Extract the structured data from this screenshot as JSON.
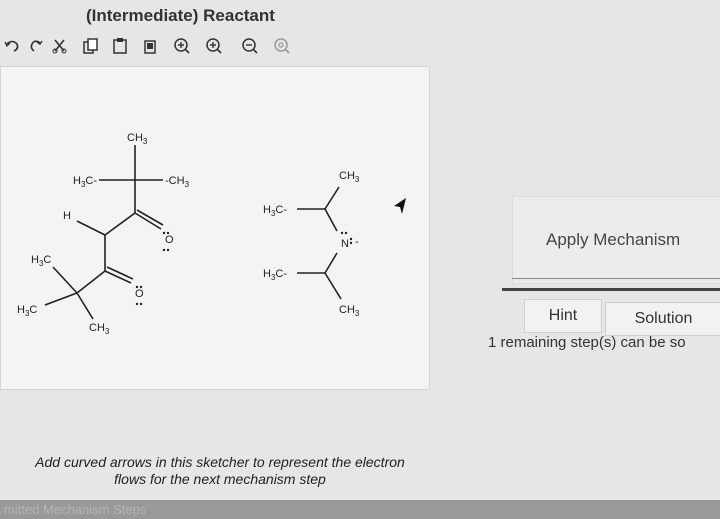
{
  "header": {
    "title": "(Intermediate) Reactant"
  },
  "toolbar": {
    "tools": [
      "undo-icon",
      "redo-icon",
      "cut-icon",
      "copy-icon",
      "paste-icon",
      "delete-icon",
      "zoom-in-icon",
      "zoom-out-icon",
      "zoom-fit-icon"
    ]
  },
  "molecule_left": {
    "labels": {
      "ch3_top": "CH",
      "h3c_mid": "H",
      "ch3_mid": "-CH",
      "h": "H",
      "h3c_left": "H",
      "h3c_bottom": "H",
      "ch3_bottom": "CH",
      "o1": "O",
      "o2": "O",
      "sub3": "3",
      "c_suffix": "C",
      "c_dash": "C-"
    }
  },
  "molecule_right": {
    "labels": {
      "ch3_top": "CH",
      "h3c_top": "H",
      "n": "N",
      "h3c_bottom": "H",
      "ch3_bottom": "CH",
      "minus": "-",
      "sub3": "3",
      "c_dash": "C-"
    }
  },
  "panel": {
    "apply_mechanism": "Apply Mechanism",
    "hint": "Hint",
    "solution": "Solution",
    "remaining": "1 remaining step(s) can be so"
  },
  "instructions": {
    "line1": "Add curved arrows in this sketcher to represent the electron",
    "line2": "flows for the next mechanism step"
  },
  "footer": {
    "text": "mitted Mechanism Steps"
  }
}
